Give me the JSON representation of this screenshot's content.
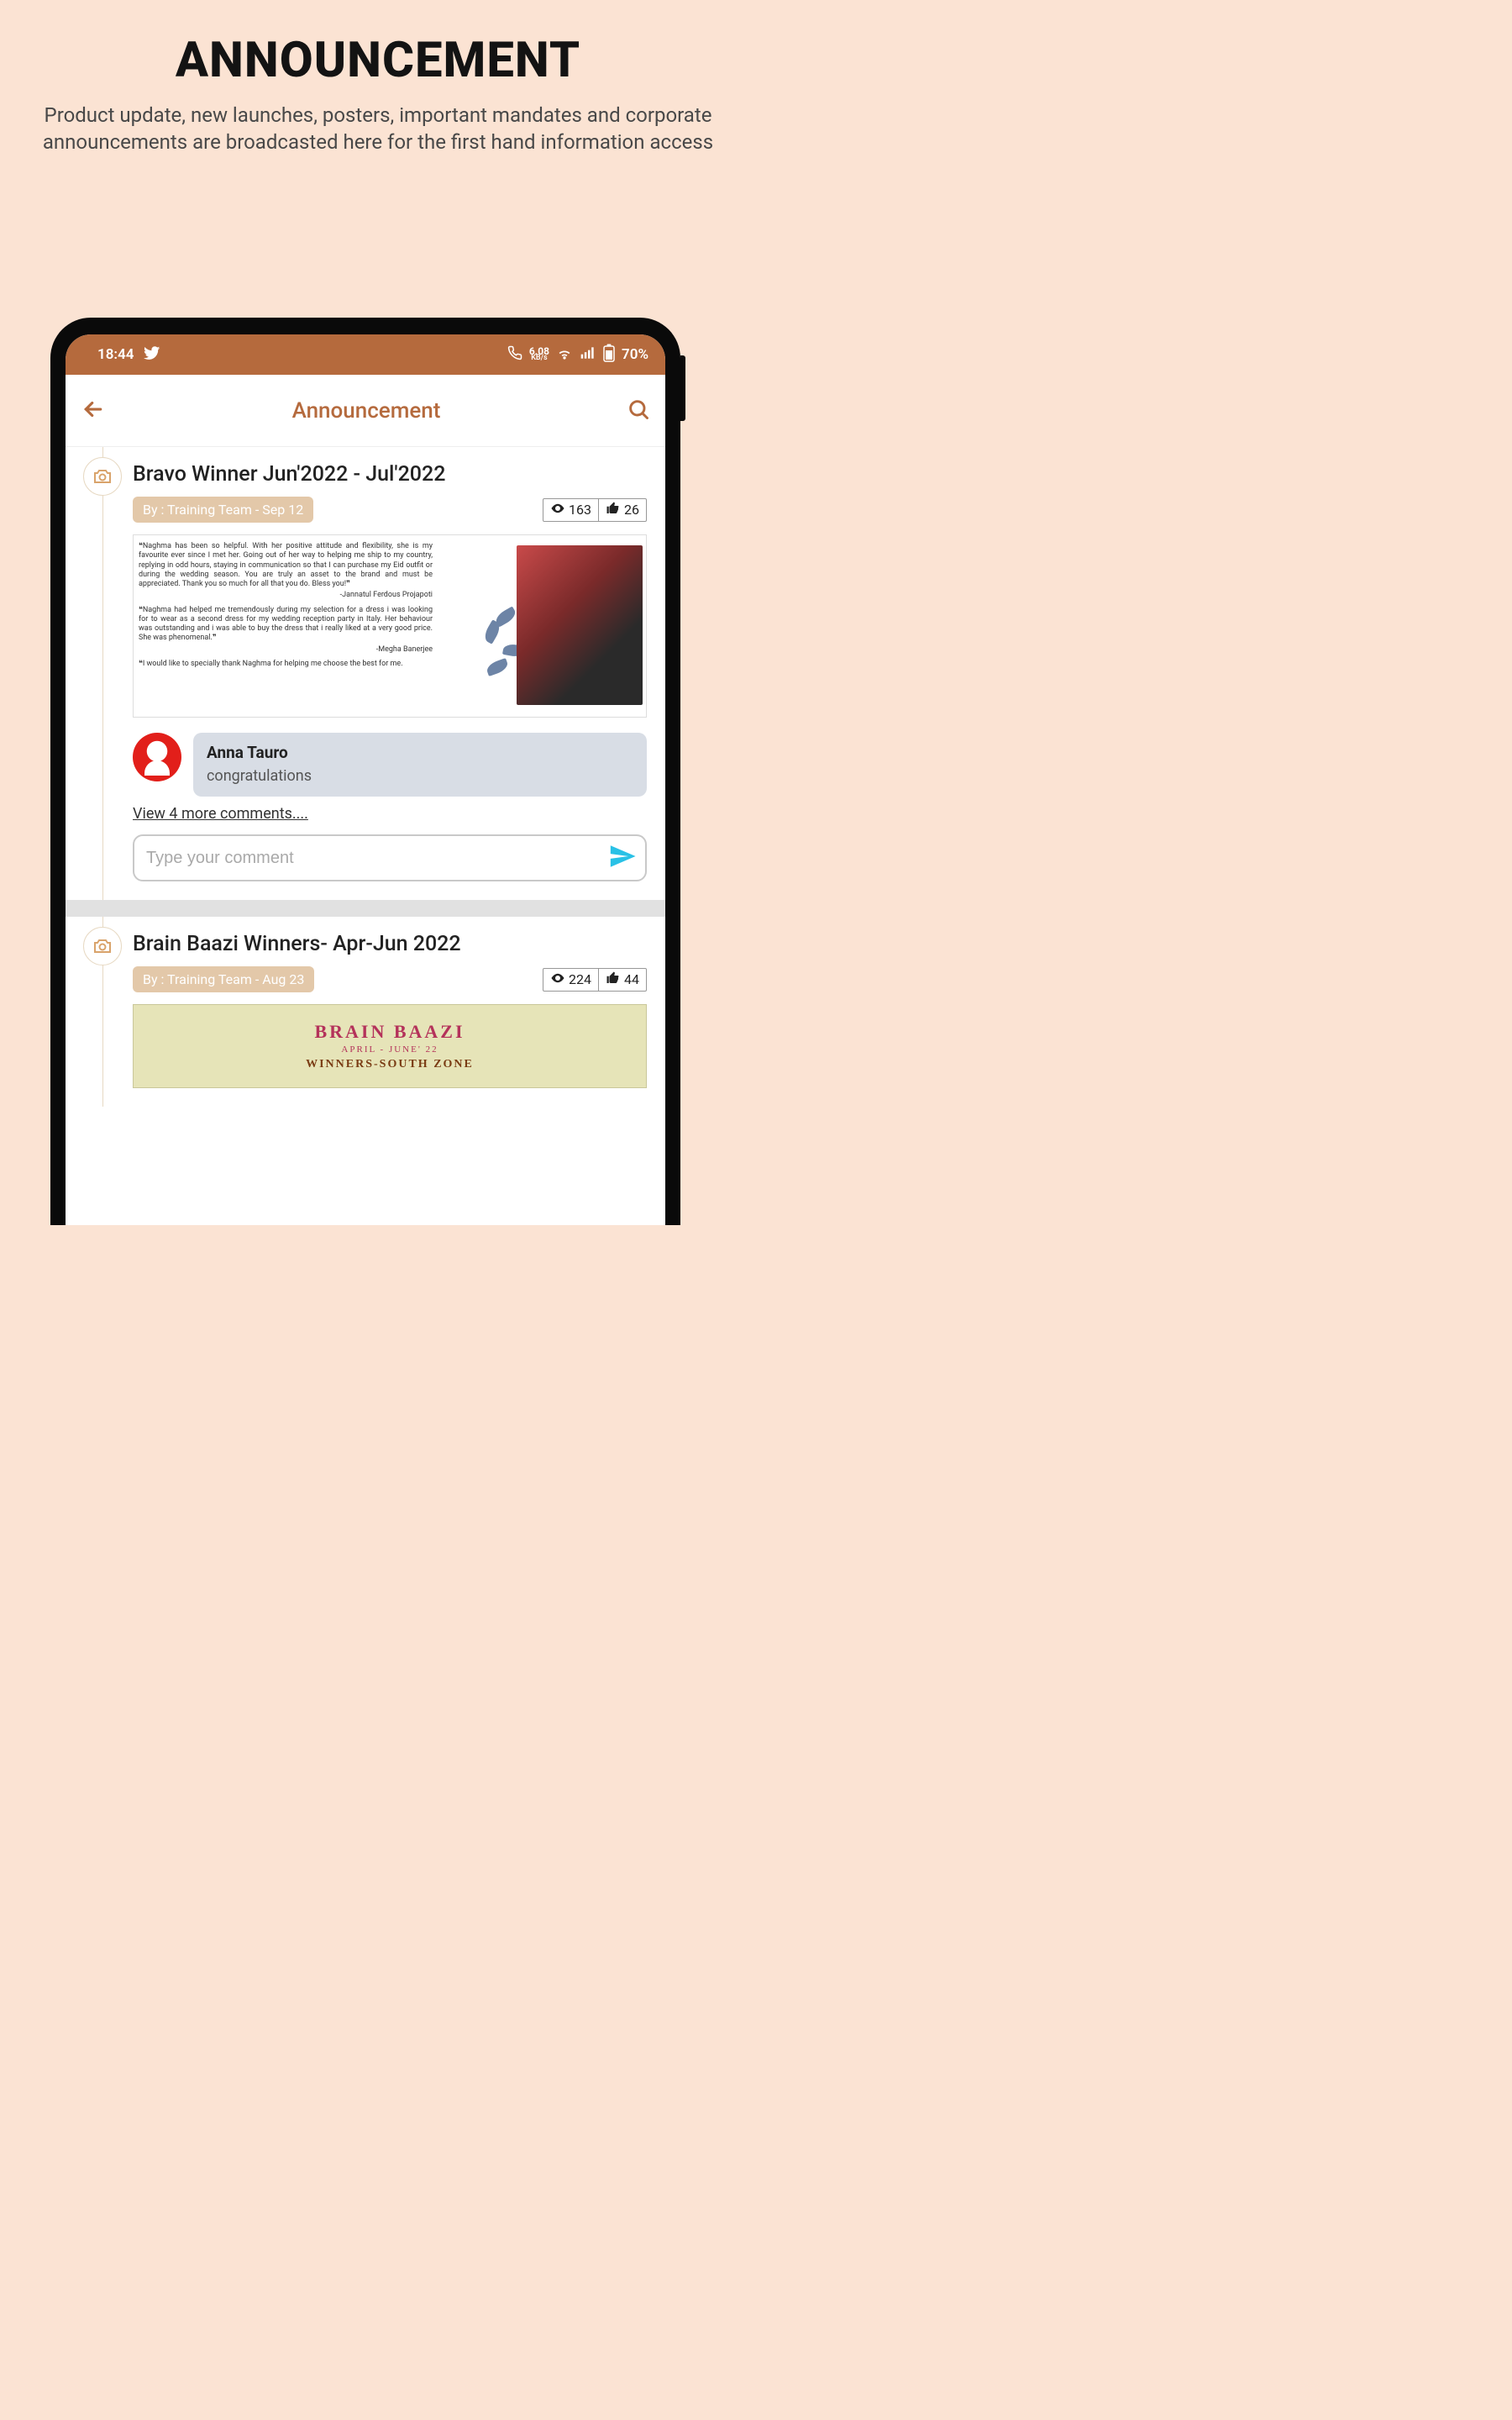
{
  "hero": {
    "title": "ANNOUNCEMENT",
    "subtitle": "Product update, new launches, posters, important mandates and corporate announcements are broadcasted here for the first hand information access"
  },
  "status": {
    "time": "18:44",
    "data_rate": "6.08",
    "data_unit": "KB/s",
    "battery": "70%"
  },
  "appbar": {
    "title": "Announcement"
  },
  "posts": [
    {
      "title": "Bravo Winner Jun'2022 - Jul'2022",
      "byline": "By : Training Team - Sep 12",
      "views": "163",
      "likes": "26",
      "quotes": [
        {
          "text": "Naghma has been so helpful. With her positive attitude and flexibility, she is my favourite ever since I met her. Going out of her way to helping me ship to my country, replying in odd hours, staying in communication so that I can purchase my Eid outfit or during the wedding season. You are truly an asset to the brand and must be appreciated. Thank you so much for all that you do. Bless you!",
          "author": "-Jannatul Ferdous Projapoti"
        },
        {
          "text": "Naghma had helped me tremendously during my selection for a dress i was looking for to wear as a second dress for my wedding reception party in Italy. Her behaviour was outstanding and i was able to buy the dress that i really liked at a very good price. She was phenomenal.",
          "author": "-Megha Banerjee"
        },
        {
          "text": "I would like to specially thank Naghma for helping me choose the best for me.",
          "author": ""
        }
      ],
      "comment": {
        "name": "Anna Tauro",
        "text": "congratulations"
      },
      "view_more": "View 4 more comments....",
      "input_placeholder": "Type your comment"
    },
    {
      "title": "Brain Baazi Winners- Apr-Jun 2022",
      "byline": "By : Training Team - Aug 23",
      "views": "224",
      "likes": "44",
      "banner": {
        "t1": "BRAIN BAAZI",
        "t2": "APRIL - JUNE' 22",
        "t3": "WINNERS-SOUTH ZONE"
      }
    }
  ]
}
